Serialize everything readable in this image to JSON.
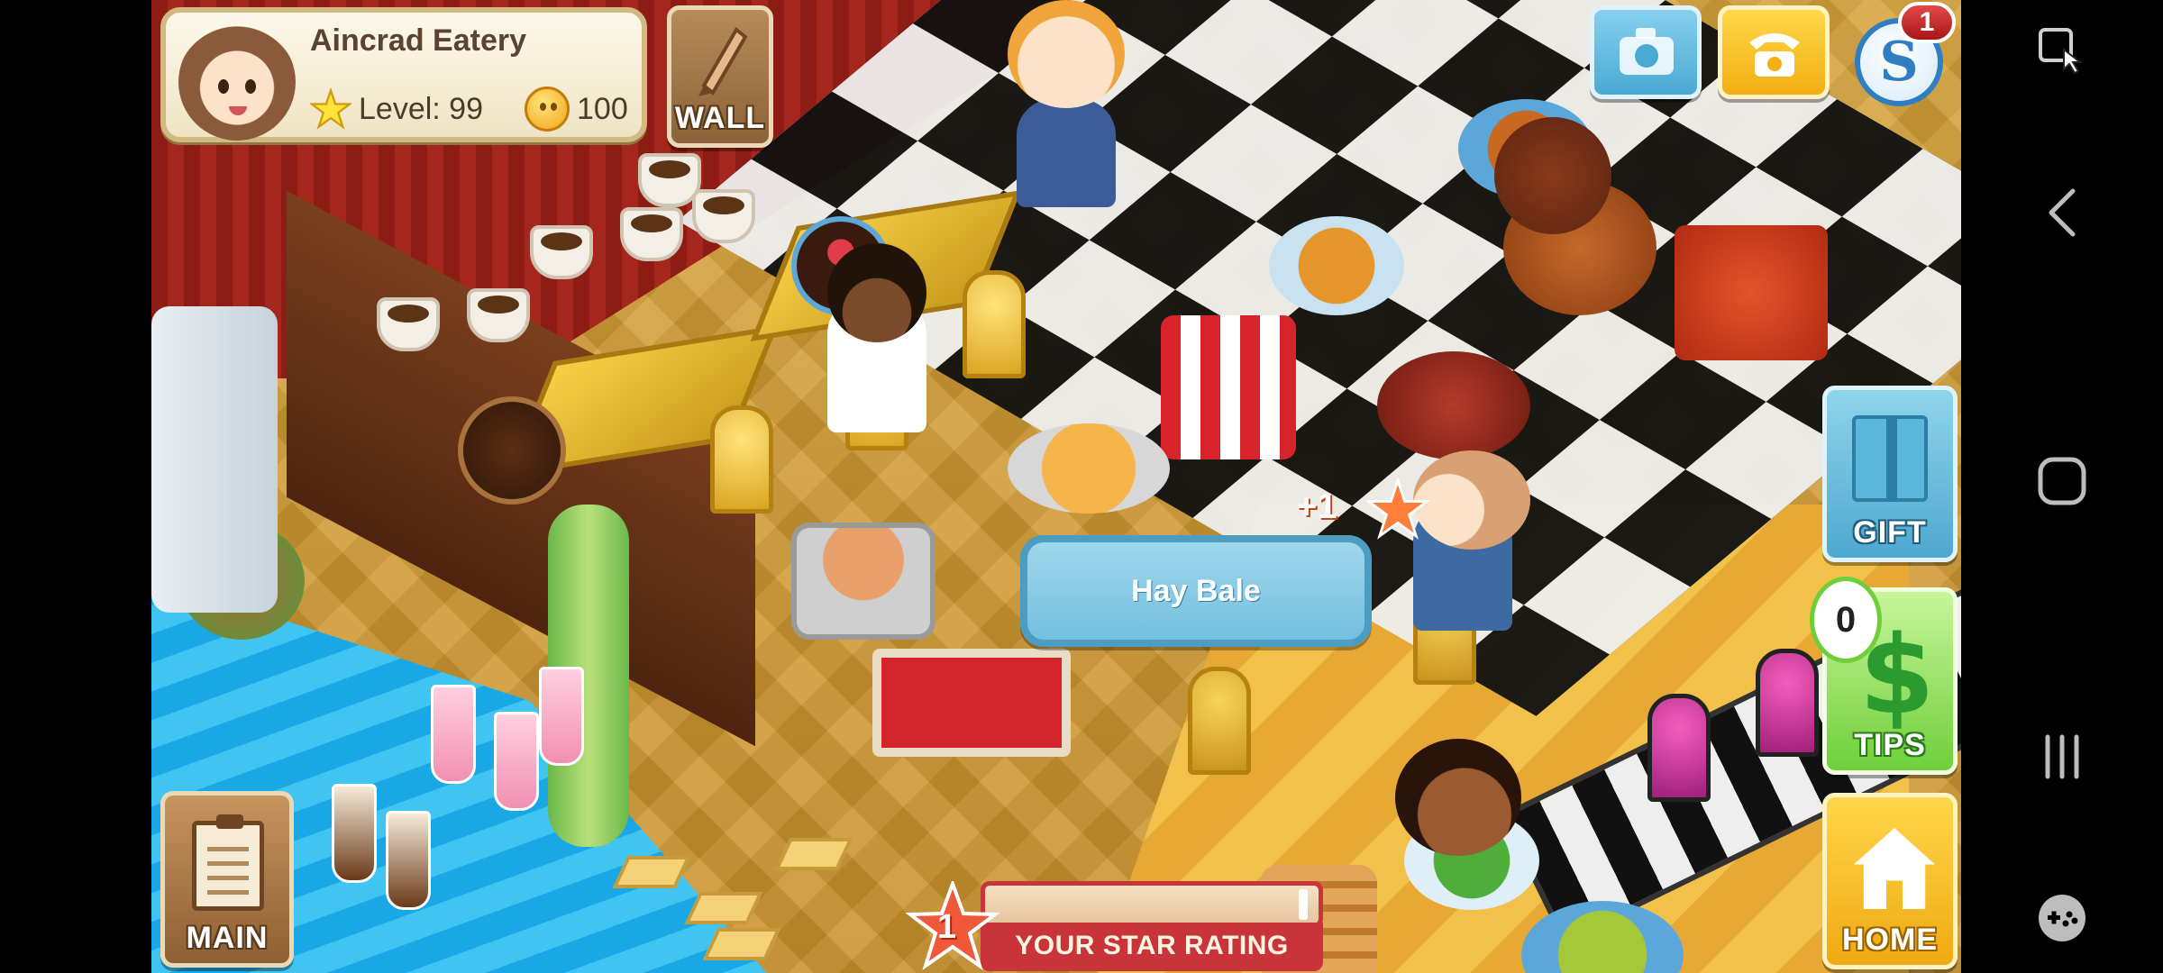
{
  "restaurant": {
    "name": "Aincrad Eatery",
    "level": "Level: 99",
    "coins": "100"
  },
  "buttons": {
    "wall": "WALL",
    "gift": "GIFT",
    "tips": "TIPS",
    "home": "HOME",
    "main": "MAIN"
  },
  "notifications": {
    "badge_count": "1",
    "tips_count": "0"
  },
  "tooltip": {
    "label": "Hay Bale"
  },
  "floating_reward": {
    "text": "+1"
  },
  "star_rating": {
    "value": "1",
    "label": "YOUR STAR RATING",
    "progress_fraction": 0.97
  },
  "icons": {
    "top_right": [
      "camera-icon",
      "phone-icon",
      "s-currency-icon"
    ],
    "navbar": [
      "screen-pin-icon",
      "back-icon",
      "home-circle-icon",
      "recents-icon",
      "game-controller-icon"
    ]
  },
  "colors": {
    "tooltip_bg": "#74bfe0",
    "rating_red": "#c9343a",
    "gold": "#f2ae12"
  }
}
